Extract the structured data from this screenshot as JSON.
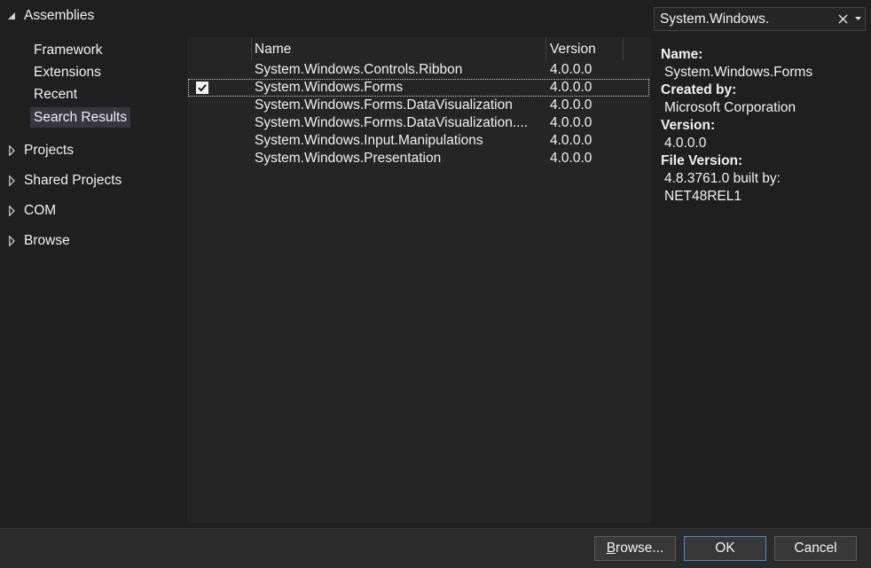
{
  "sidebar": {
    "assemblies": {
      "label": "Assemblies",
      "expanded": true,
      "items": [
        {
          "label": "Framework"
        },
        {
          "label": "Extensions"
        },
        {
          "label": "Recent"
        },
        {
          "label": "Search Results",
          "selected": true
        }
      ]
    },
    "groups": [
      {
        "label": "Projects"
      },
      {
        "label": "Shared Projects"
      },
      {
        "label": "COM"
      },
      {
        "label": "Browse"
      }
    ]
  },
  "search": {
    "value": "System.Windows."
  },
  "list": {
    "columns": {
      "name": "Name",
      "version": "Version"
    },
    "rows": [
      {
        "name": "System.Windows.Controls.Ribbon",
        "version": "4.0.0.0",
        "checked": false
      },
      {
        "name": "System.Windows.Forms",
        "version": "4.0.0.0",
        "checked": true,
        "selected": true
      },
      {
        "name": "System.Windows.Forms.DataVisualization",
        "version": "4.0.0.0",
        "checked": false
      },
      {
        "name": "System.Windows.Forms.DataVisualization....",
        "version": "4.0.0.0",
        "checked": false
      },
      {
        "name": "System.Windows.Input.Manipulations",
        "version": "4.0.0.0",
        "checked": false
      },
      {
        "name": "System.Windows.Presentation",
        "version": "4.0.0.0",
        "checked": false
      }
    ]
  },
  "details": {
    "name_label": "Name:",
    "name_value": "System.Windows.Forms",
    "created_by_label": "Created by:",
    "created_by_value": "Microsoft Corporation",
    "version_label": "Version:",
    "version_value": "4.0.0.0",
    "file_version_label": "File Version:",
    "file_version_line1": "4.8.3761.0 built by:",
    "file_version_line2": "NET48REL1"
  },
  "buttons": {
    "browse": "Browse...",
    "ok": "OK",
    "cancel": "Cancel"
  },
  "icons": {
    "expanded": "expanded-triangle-icon",
    "collapsed": "collapsed-triangle-icon",
    "search_clear": "clear-icon",
    "search_dropdown": "chevron-down-icon",
    "checkbox": "checkmark-icon"
  },
  "colors": {
    "background": "#1f1f1f",
    "panel": "#252526",
    "text": "#f1f1f1",
    "selection": "#37373d",
    "accent": "#3b8eea",
    "button": "#383838",
    "button_border": "#5a5a5a",
    "footer": "#2b2b2b"
  }
}
